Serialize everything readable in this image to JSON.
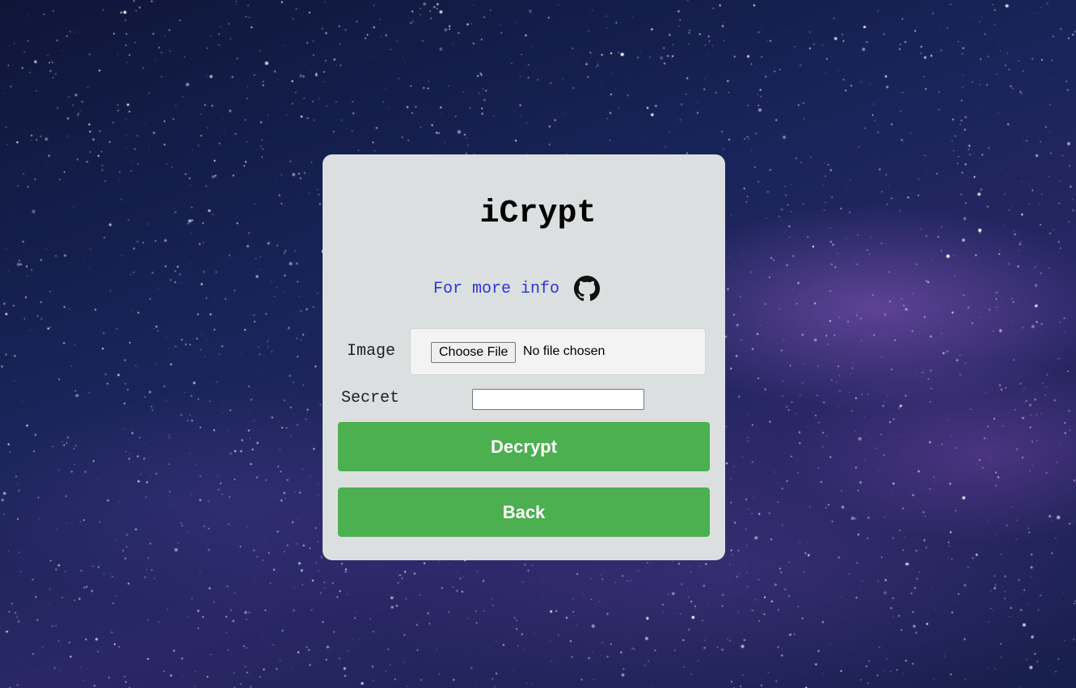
{
  "app": {
    "title": "iCrypt"
  },
  "info": {
    "link_text": "For more info",
    "icon": "github-icon"
  },
  "form": {
    "image_label": "Image",
    "file_button_label": "Choose File",
    "file_status": "No file chosen",
    "secret_label": "Secret",
    "secret_value": "",
    "secret_placeholder": ""
  },
  "buttons": {
    "decrypt_label": "Decrypt",
    "back_label": "Back"
  },
  "colors": {
    "card_background": "#dcdfe0",
    "button_green": "#4caf50",
    "link_blue": "#2b35d6"
  }
}
